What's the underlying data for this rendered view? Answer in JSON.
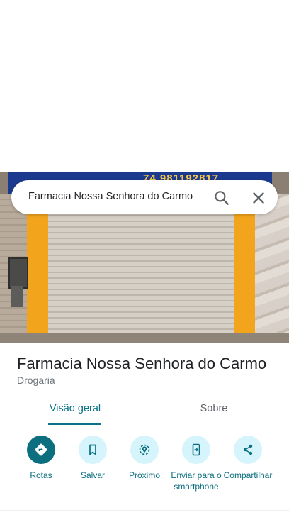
{
  "photo": {
    "sign_phone": "74 981192817"
  },
  "search": {
    "query": "Farmacia Nossa Senhora do Carmo",
    "search_icon": "search-icon",
    "close_icon": "close-icon"
  },
  "place": {
    "title": "Farmacia Nossa Senhora do Carmo",
    "category": "Drogaria"
  },
  "tabs": [
    {
      "label": "Visão geral",
      "active": true
    },
    {
      "label": "Sobre",
      "active": false
    }
  ],
  "actions": [
    {
      "label": "Rotas",
      "icon": "directions-icon"
    },
    {
      "label": "Salvar",
      "icon": "bookmark-icon"
    },
    {
      "label": "Próximo",
      "icon": "nearby-icon"
    },
    {
      "label": "Enviar para o smartphone",
      "icon": "send-to-phone-icon"
    },
    {
      "label": "Compartilhar",
      "icon": "share-icon"
    }
  ],
  "colors": {
    "accent": "#0b6f7f",
    "accent_light": "#d6f4fb",
    "text": "#202124",
    "secondary_text": "#70757a"
  }
}
